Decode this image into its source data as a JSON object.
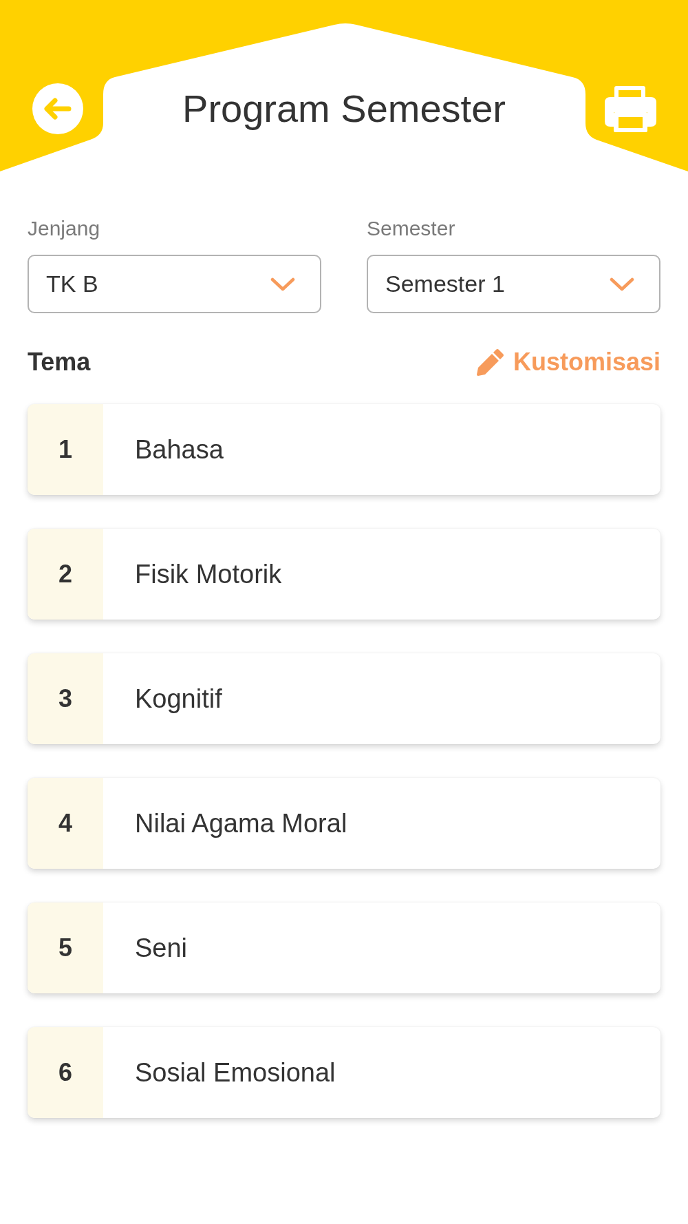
{
  "header": {
    "title": "Program Semester"
  },
  "filters": [
    {
      "label": "Jenjang",
      "value": "TK B"
    },
    {
      "label": "Semester",
      "value": "Semester 1"
    }
  ],
  "section": {
    "title": "Tema",
    "action": "Kustomisasi"
  },
  "themes": [
    {
      "number": "1",
      "name": "Bahasa"
    },
    {
      "number": "2",
      "name": "Fisik Motorik"
    },
    {
      "number": "3",
      "name": "Kognitif"
    },
    {
      "number": "4",
      "name": "Nilai Agama Moral"
    },
    {
      "number": "5",
      "name": "Seni"
    },
    {
      "number": "6",
      "name": "Sosial Emosional"
    }
  ]
}
